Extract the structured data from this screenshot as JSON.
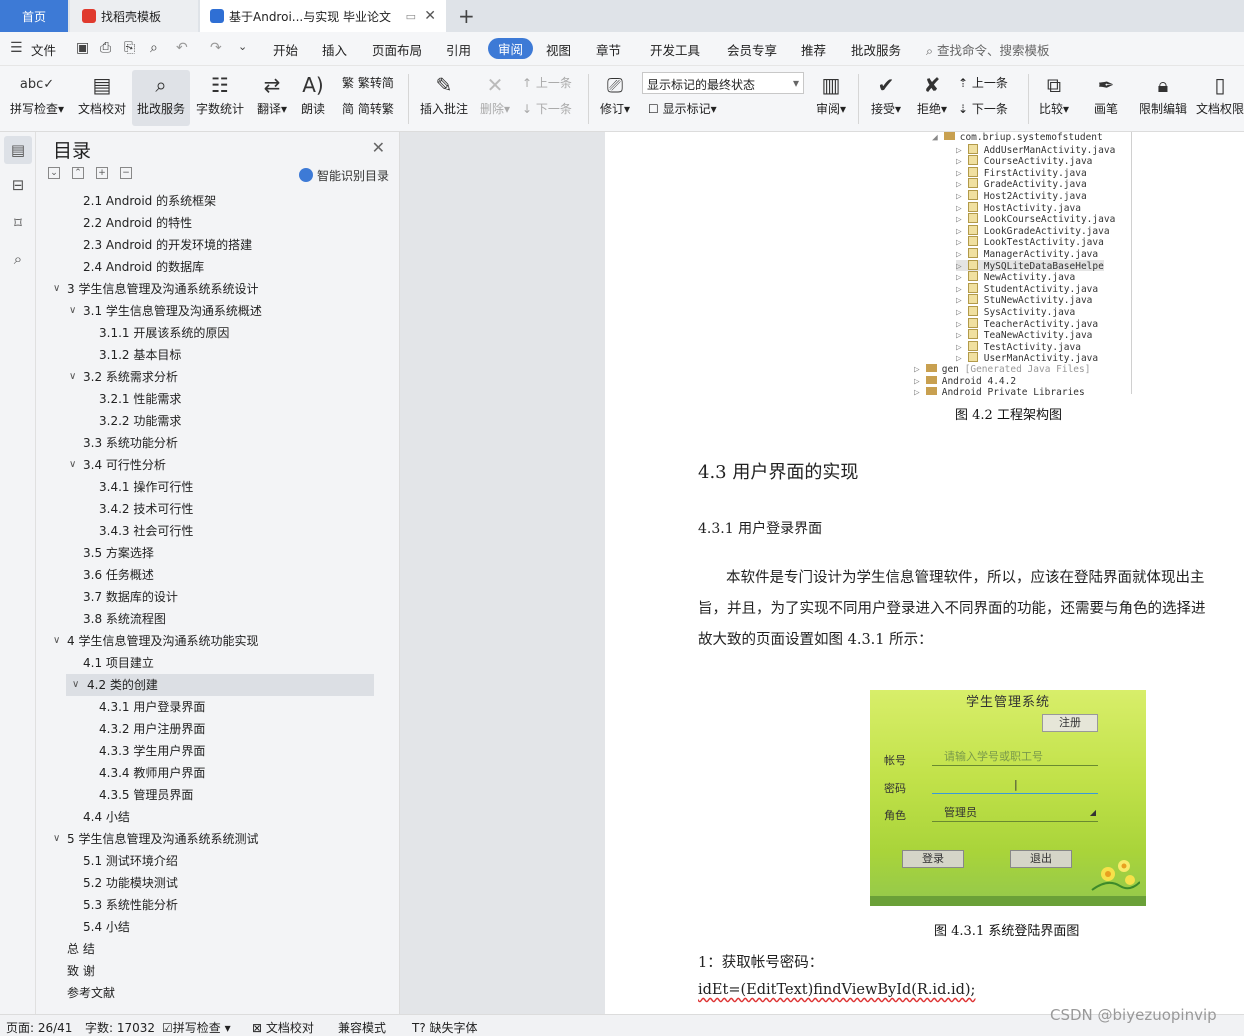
{
  "tabs": [
    {
      "label": "首页"
    },
    {
      "label": "找稻壳模板"
    },
    {
      "label": "基于Androi...与实现 毕业论文"
    }
  ],
  "menu": {
    "file": "文件",
    "items": [
      "开始",
      "插入",
      "页面布局",
      "引用",
      "审阅",
      "视图",
      "章节",
      "开发工具",
      "会员专享",
      "推荐",
      "批改服务"
    ],
    "active": "审阅",
    "search_placeholder": "查找命令、搜索模板"
  },
  "ribbon": {
    "spell": "拼写检查",
    "doc_check": "文档校对",
    "review_service": "批改服务",
    "word_count": "字数统计",
    "translate": "翻译",
    "read_aloud": "朗读",
    "trad": "繁转简",
    "simp": "简转繁",
    "insert_comment": "插入批注",
    "delete": "删除",
    "prev": "上一条",
    "next": "下一条",
    "track": "修订",
    "markup_state": "显示标记的最终状态",
    "show_markup": "显示标记",
    "review": "审阅",
    "accept": "接受",
    "reject": "拒绝",
    "prev2": "上一条",
    "next2": "下一条",
    "compare": "比较",
    "pen": "画笔",
    "restrict": "限制编辑",
    "doc_perm": "文档权限"
  },
  "toc": {
    "title": "目录",
    "smart": "智能识别目录",
    "items": [
      {
        "label": "2.1 Android 的系统框架",
        "level": 2,
        "chev": ""
      },
      {
        "label": "2.2 Android 的特性",
        "level": 2,
        "chev": ""
      },
      {
        "label": "2.3 Android 的开发环境的搭建",
        "level": 2,
        "chev": ""
      },
      {
        "label": "2.4 Android 的数据库",
        "level": 2,
        "chev": ""
      },
      {
        "label": "3  学生信息管理及沟通系统系统设计",
        "level": 1,
        "chev": "∨"
      },
      {
        "label": "3.1  学生信息管理及沟通系统概述",
        "level": 2,
        "chev": "∨"
      },
      {
        "label": "3.1.1 开展该系统的原因",
        "level": 3,
        "chev": ""
      },
      {
        "label": "3.1.2  基本目标",
        "level": 3,
        "chev": ""
      },
      {
        "label": "3.2  系统需求分析",
        "level": 2,
        "chev": "∨"
      },
      {
        "label": "3.2.1  性能需求",
        "level": 3,
        "chev": ""
      },
      {
        "label": "3.2.2  功能需求",
        "level": 3,
        "chev": ""
      },
      {
        "label": "3.3  系统功能分析",
        "level": 2,
        "chev": ""
      },
      {
        "label": "3.4  可行性分析",
        "level": 2,
        "chev": "∨"
      },
      {
        "label": "3.4.1 操作可行性",
        "level": 3,
        "chev": ""
      },
      {
        "label": "3.4.2 技术可行性",
        "level": 3,
        "chev": ""
      },
      {
        "label": "3.4.3 社会可行性",
        "level": 3,
        "chev": ""
      },
      {
        "label": "3.5  方案选择",
        "level": 2,
        "chev": ""
      },
      {
        "label": "3.6  任务概述",
        "level": 2,
        "chev": ""
      },
      {
        "label": "3.7  数据库的设计",
        "level": 2,
        "chev": ""
      },
      {
        "label": "3.8  系统流程图",
        "level": 2,
        "chev": ""
      },
      {
        "label": "4  学生信息管理及沟通系统功能实现",
        "level": 1,
        "chev": "∨"
      },
      {
        "label": "4.1  项目建立",
        "level": 2,
        "chev": ""
      },
      {
        "label": "4.2  类的创建",
        "level": 2,
        "chev": "∨",
        "selected": true
      },
      {
        "label": "4.3.1  用户登录界面",
        "level": 3,
        "chev": ""
      },
      {
        "label": "4.3.2  用户注册界面",
        "level": 3,
        "chev": ""
      },
      {
        "label": "4.3.3  学生用户界面",
        "level": 3,
        "chev": ""
      },
      {
        "label": "4.3.4  教师用户界面",
        "level": 3,
        "chev": ""
      },
      {
        "label": "4.3.5  管理员界面",
        "level": 3,
        "chev": ""
      },
      {
        "label": "4.4  小结",
        "level": 2,
        "chev": ""
      },
      {
        "label": "5  学生信息管理及沟通系统系统测试",
        "level": 1,
        "chev": "∨"
      },
      {
        "label": "5.1  测试环境介绍",
        "level": 2,
        "chev": ""
      },
      {
        "label": "5.2  功能模块测试",
        "level": 2,
        "chev": ""
      },
      {
        "label": "5.3  系统性能分析",
        "level": 2,
        "chev": ""
      },
      {
        "label": "5.4  小结",
        "level": 2,
        "chev": ""
      },
      {
        "label": "总   结",
        "level": 0,
        "chev": ""
      },
      {
        "label": "致   谢",
        "level": 0,
        "chev": ""
      },
      {
        "label": "参考文献",
        "level": 0,
        "chev": ""
      }
    ]
  },
  "doc": {
    "tree_pkg": "com.briup.systemofstudent",
    "tree_files": [
      "AddUserManActivity.java",
      "CourseActivity.java",
      "FirstActivity.java",
      "GradeActivity.java",
      "Host2Activity.java",
      "HostActivity.java",
      "LookCourseActivity.java",
      "LookGradeActivity.java",
      "LookTestActivity.java",
      "ManagerActivity.java",
      "MySQLiteDataBaseHelpe",
      "NewActivity.java",
      "StudentActivity.java",
      "StuNewActivity.java",
      "SysActivity.java",
      "TeacherActivity.java",
      "TeaNewActivity.java",
      "TestActivity.java",
      "UserManActivity.java"
    ],
    "tree_gen": "gen",
    "tree_gen_note": "[Generated Java Files]",
    "tree_android": "Android 4.4.2",
    "tree_private": "Android Private Libraries",
    "fig1_caption": "图 4.2 工程架构图",
    "h2": "4.3  用户界面的实现",
    "h3": "4.3.1  用户登录界面",
    "para1": "本软件是专门设计为学生信息管理软件，所以，应该在登陆界面就体现出主",
    "para2": "旨，并且，为了实现不同用户登录进入不同界面的功能，还需要与角色的选择进",
    "para3": "故大致的页面设置如图 4.3.1 所示：",
    "phone": {
      "title": "学生管理系统",
      "register": "注册",
      "account_label": "帐号",
      "account_placeholder": "请输入学号或职工号",
      "password_label": "密码",
      "role_label": "角色",
      "role_value": "管理员",
      "login": "登录",
      "exit": "退出"
    },
    "fig2_caption": "图 4.3.1  系统登陆界面图",
    "step1": "1：获取帐号密码：",
    "code1": "idEt=(EditText)findViewById(R.id.id);"
  },
  "status": {
    "page": "页面: 26/41",
    "words": "字数: 17032",
    "spell": "拼写检查",
    "doc_check": "文档校对",
    "compat": "兼容模式",
    "missing_font": "缺失字体"
  },
  "watermark": "CSDN @biyezuopinvip"
}
